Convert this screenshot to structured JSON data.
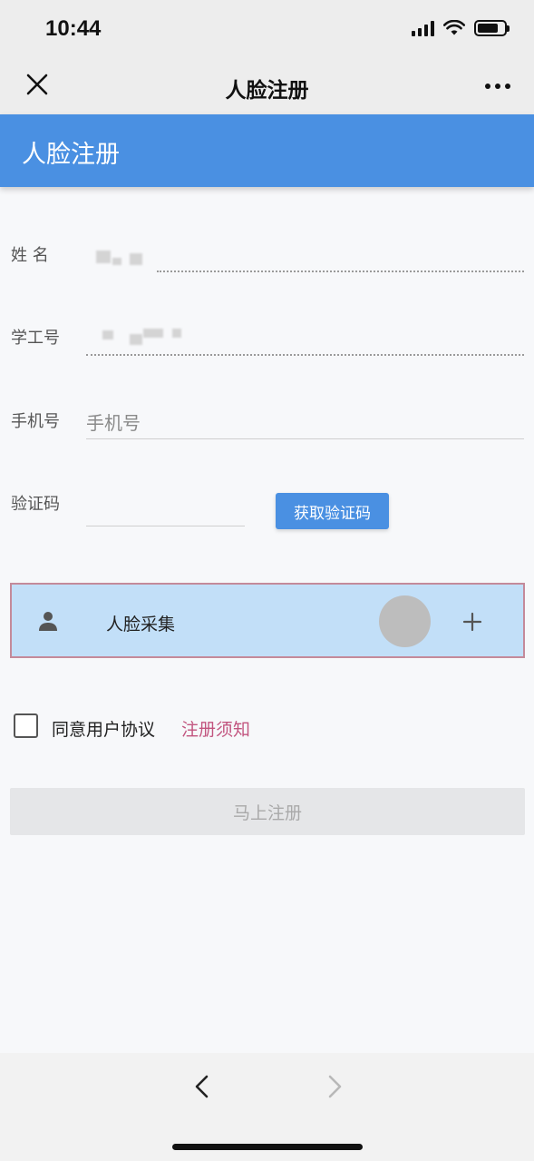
{
  "status_bar": {
    "time": "10:44"
  },
  "nav": {
    "title": "人脸注册"
  },
  "header": {
    "title": "人脸注册"
  },
  "form": {
    "name_label": "姓 名",
    "student_id_label": "学工号",
    "phone_label": "手机号",
    "phone_placeholder": "手机号",
    "code_label": "验证码",
    "get_code_button": "获取验证码",
    "face_capture_label": "人脸采集",
    "agree_label": "同意用户协议",
    "agree_link": "注册须知",
    "submit_button": "马上注册"
  },
  "colors": {
    "accent": "#4a90e2",
    "link": "#c2557f",
    "face_box_bg": "#c2dff8"
  }
}
